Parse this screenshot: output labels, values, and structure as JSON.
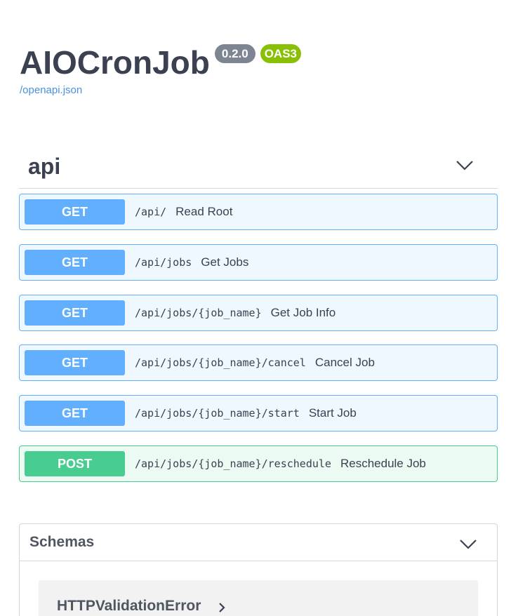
{
  "info": {
    "title": "AIOCronJob",
    "version": "0.2.0",
    "spec_badge": "OAS3",
    "spec_link": "/openapi.json"
  },
  "tag": {
    "name": "api",
    "chevron_icon": "chevron-down-icon"
  },
  "operations": [
    {
      "method": "GET",
      "path": "/api/",
      "summary": "Read Root"
    },
    {
      "method": "GET",
      "path": "/api/jobs",
      "summary": "Get Jobs"
    },
    {
      "method": "GET",
      "path": "/api/jobs/{job_name}",
      "summary": "Get Job Info"
    },
    {
      "method": "GET",
      "path": "/api/jobs/{job_name}/cancel",
      "summary": "Cancel Job"
    },
    {
      "method": "GET",
      "path": "/api/jobs/{job_name}/start",
      "summary": "Start Job"
    },
    {
      "method": "POST",
      "path": "/api/jobs/{job_name}/reschedule",
      "summary": "Reschedule Job"
    }
  ],
  "schemas": {
    "title": "Schemas",
    "chevron_icon": "chevron-down-icon",
    "models": [
      {
        "name": "HTTPValidationError",
        "toggle_icon": "chevron-right-icon"
      }
    ]
  },
  "colors": {
    "get": "#61affe",
    "post": "#49cc90",
    "text": "#3b4151",
    "link": "#4990e2",
    "version_badge": "#7d8492",
    "oas_badge": "#89bf04"
  }
}
